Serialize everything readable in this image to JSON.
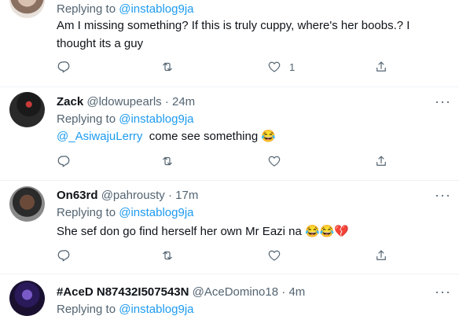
{
  "tweets": [
    {
      "replying_prefix": "Replying to",
      "replying_handle": "@instablog9ja",
      "text": "Am I missing something? If this is truly cuppy, where's her boobs.? I thought its a guy",
      "like_count": "1"
    },
    {
      "display_name": "Zack",
      "handle": "@ldowupearls",
      "separator": "·",
      "time": "24m",
      "replying_prefix": "Replying to",
      "replying_handle": "@instablog9ja",
      "mention": "@_AsiwajuLerry",
      "text": "come see something 😂"
    },
    {
      "display_name": "On63rd",
      "handle": "@pahrousty",
      "separator": "·",
      "time": "17m",
      "replying_prefix": "Replying to",
      "replying_handle": "@instablog9ja",
      "text": "She sef don go find herself her own Mr Eazi na 😂😂💔"
    },
    {
      "display_name": "#AceD N87432I507543N",
      "handle": "@AceDomino18",
      "separator": "·",
      "time": "4m",
      "replying_prefix": "Replying to",
      "replying_handle": "@instablog9ja"
    }
  ],
  "more_label": "···",
  "colors": {
    "link": "#1d9bf0",
    "muted": "#536471",
    "text": "#0f1419"
  },
  "icons": [
    "reply-icon",
    "retweet-icon",
    "like-icon",
    "share-icon",
    "more-icon"
  ]
}
